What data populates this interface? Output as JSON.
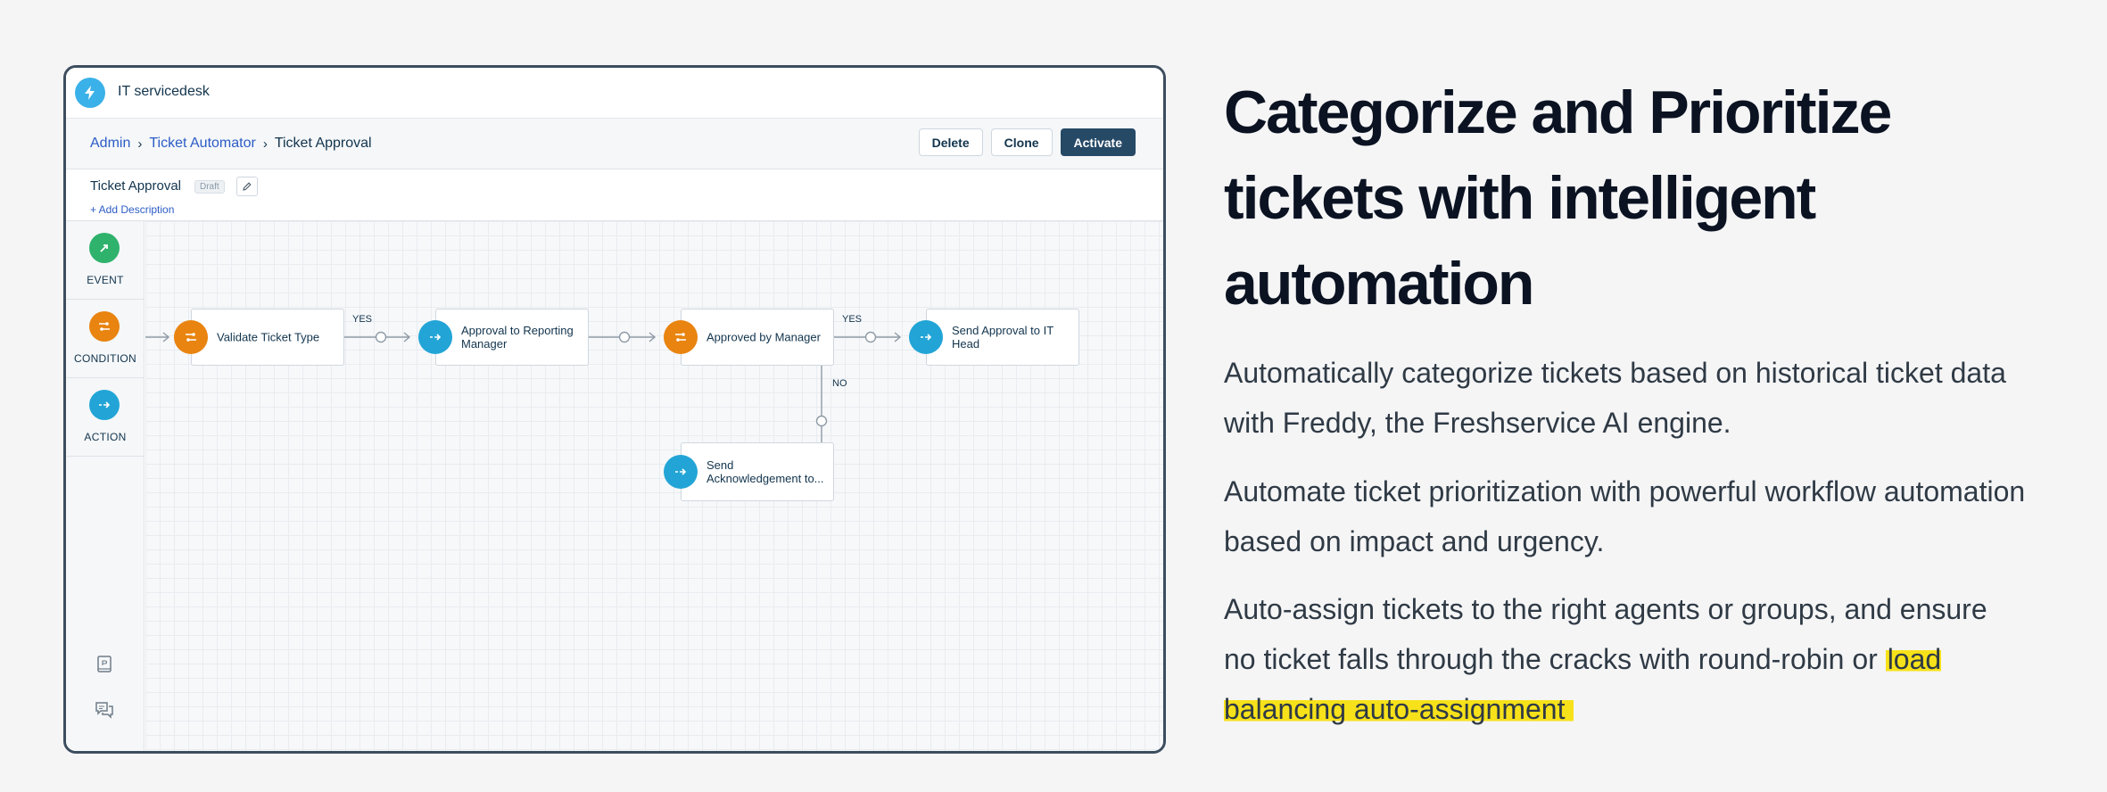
{
  "app": {
    "title": "IT servicedesk",
    "accent": "#3ab1e8"
  },
  "breadcrumb": {
    "items": [
      "Admin",
      "Ticket Automator"
    ],
    "current": "Ticket Approval"
  },
  "toolbar": {
    "delete_label": "Delete",
    "clone_label": "Clone",
    "activate_label": "Activate"
  },
  "workflow": {
    "name": "Ticket Approval",
    "status": "Draft",
    "add_description": "+ Add Description"
  },
  "palette": {
    "items": [
      {
        "label": "EVENT",
        "color": "#2fb26c",
        "icon": "pointer-icon"
      },
      {
        "label": "CONDITION",
        "color": "#e8840f",
        "icon": "condition-icon"
      },
      {
        "label": "ACTION",
        "color": "#22a5d6",
        "icon": "action-icon"
      }
    ],
    "footer_icons": [
      "notebook-icon",
      "chat-icon"
    ]
  },
  "canvas": {
    "nodes": [
      {
        "label": "Validate Ticket Type",
        "kind": "condition"
      },
      {
        "label": "Approval to Reporting Manager",
        "kind": "action"
      },
      {
        "label": "Approved by Manager",
        "kind": "condition"
      },
      {
        "label": "Send Approval to IT Head",
        "kind": "action"
      },
      {
        "label": "Send Acknowledgement to...",
        "kind": "action"
      }
    ],
    "edges": {
      "yes_1": "YES",
      "yes_2": "YES",
      "no_1": "NO"
    }
  },
  "marketing": {
    "headline": "Categorize and Prioritize tickets with intelligent automation",
    "paragraph_1": "Automatically categorize tickets based on historical ticket data with Freddy, the Freshservice AI engine.",
    "paragraph_2": "Automate ticket prioritization with powerful workflow automation based on impact and urgency.",
    "paragraph_3_prefix": "Auto-assign tickets to the right agents or groups, and ensure no ticket falls through the cracks with round-robin or",
    "paragraph_3_highlight": "load balancing auto-assignment",
    "highlight_color": "#f7e11a"
  }
}
